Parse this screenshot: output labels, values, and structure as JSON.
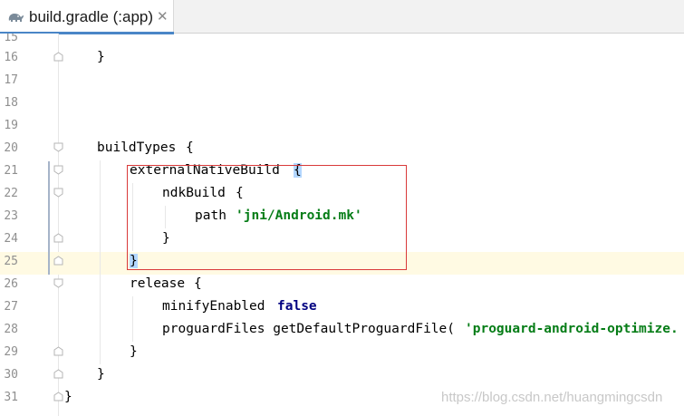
{
  "tab": {
    "title": "build.gradle (:app)",
    "close_glyph": "✕",
    "icon": "gradle-elephant-icon"
  },
  "lines": [
    {
      "num": "15",
      "text": ""
    },
    {
      "num": "16",
      "text": "}"
    },
    {
      "num": "17",
      "text": ""
    },
    {
      "num": "18",
      "text": ""
    },
    {
      "num": "19",
      "text": ""
    },
    {
      "num": "20",
      "text": "buildTypes {"
    },
    {
      "num": "21",
      "text": "externalNativeBuild {"
    },
    {
      "num": "22",
      "text": "ndkBuild {"
    },
    {
      "num": "23",
      "text": "path 'jni/Android.mk'"
    },
    {
      "num": "24",
      "text": "}"
    },
    {
      "num": "25",
      "text": "}"
    },
    {
      "num": "26",
      "text": "release {"
    },
    {
      "num": "27",
      "text": "minifyEnabled false"
    },
    {
      "num": "28",
      "text": "proguardFiles getDefaultProguardFile('proguard-android-optimize."
    },
    {
      "num": "29",
      "text": "}"
    },
    {
      "num": "30",
      "text": "}"
    },
    {
      "num": "31",
      "text": "}"
    }
  ],
  "tokens": {
    "l16_brace": "}",
    "l20_ident": "buildTypes",
    "l20_brace": "{",
    "l21_ident": "externalNativeBuild",
    "l21_brace": "{",
    "l22_ident": "ndkBuild",
    "l22_brace": "{",
    "l23_ident": "path",
    "l23_string": "'jni/Android.mk'",
    "l24_brace": "}",
    "l25_brace": "}",
    "l26_ident": "release",
    "l26_brace": "{",
    "l27_ident": "minifyEnabled",
    "l27_keyword": "false",
    "l28_ident": "proguardFiles getDefaultProguardFile(",
    "l28_string": "'proguard-android-optimize.",
    "l29_brace": "}",
    "l30_brace": "}",
    "l31_brace": "}"
  },
  "watermark": "https://blog.csdn.net/huangmingcsdn",
  "colors": {
    "keyword": "#000080",
    "string": "#067d17",
    "current_line": "#fffae3",
    "brace_highlight": "#b3d7ff",
    "annotation_box": "#d93a3a"
  }
}
